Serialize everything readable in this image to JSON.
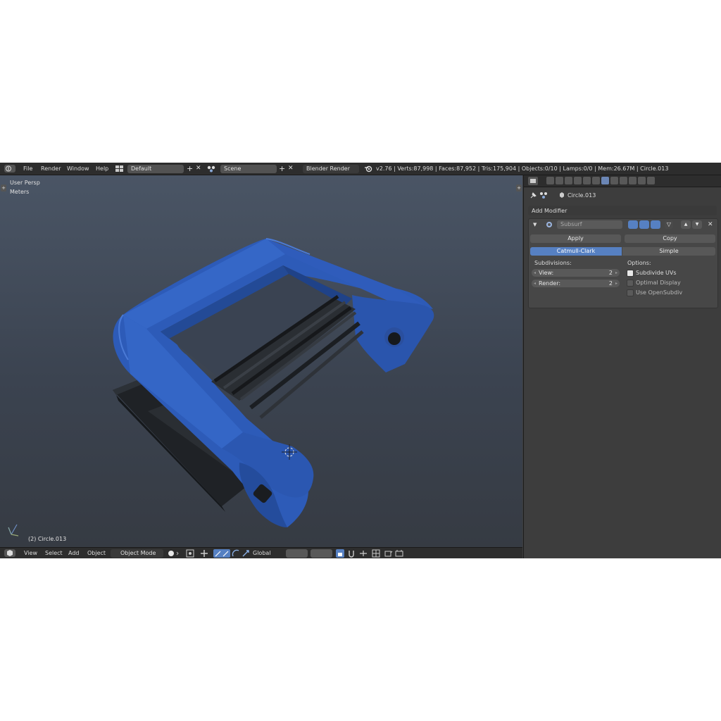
{
  "topbar": {
    "menus": [
      "File",
      "Render",
      "Window",
      "Help"
    ],
    "screen_layout": "Default",
    "scene": "Scene",
    "render_engine": "Blender Render",
    "stats": "v2.76 | Verts:87,998 | Faces:87,952 | Tris:175,904 | Objects:0/10 | Lamps:0/0 | Mem:26.67M | Circle.013"
  },
  "viewport": {
    "view_name": "User Persp",
    "units": "Meters",
    "object_label": "(2) Circle.013"
  },
  "bottombar": {
    "menus": [
      "View",
      "Select",
      "Add",
      "Object"
    ],
    "mode": "Object Mode",
    "orientation": "Global"
  },
  "properties": {
    "object_name": "Circle.013",
    "add_modifier": "Add Modifier",
    "modifier": {
      "name": "Subsurf",
      "apply": "Apply",
      "copy": "Copy",
      "type_catmull": "Catmull-Clark",
      "type_simple": "Simple",
      "subdivisions_label": "Subdivisions:",
      "view_label": "View:",
      "view_value": "2",
      "render_label": "Render:",
      "render_value": "2",
      "options_label": "Options:",
      "subdivide_uvs": "Subdivide UVs",
      "optimal_display": "Optimal Display",
      "use_opensubdiv": "Use OpenSubdiv"
    }
  },
  "colors": {
    "accent": "#5680c2",
    "model_blue": "#2f5bb0",
    "rod_dark": "#2a2e33"
  }
}
